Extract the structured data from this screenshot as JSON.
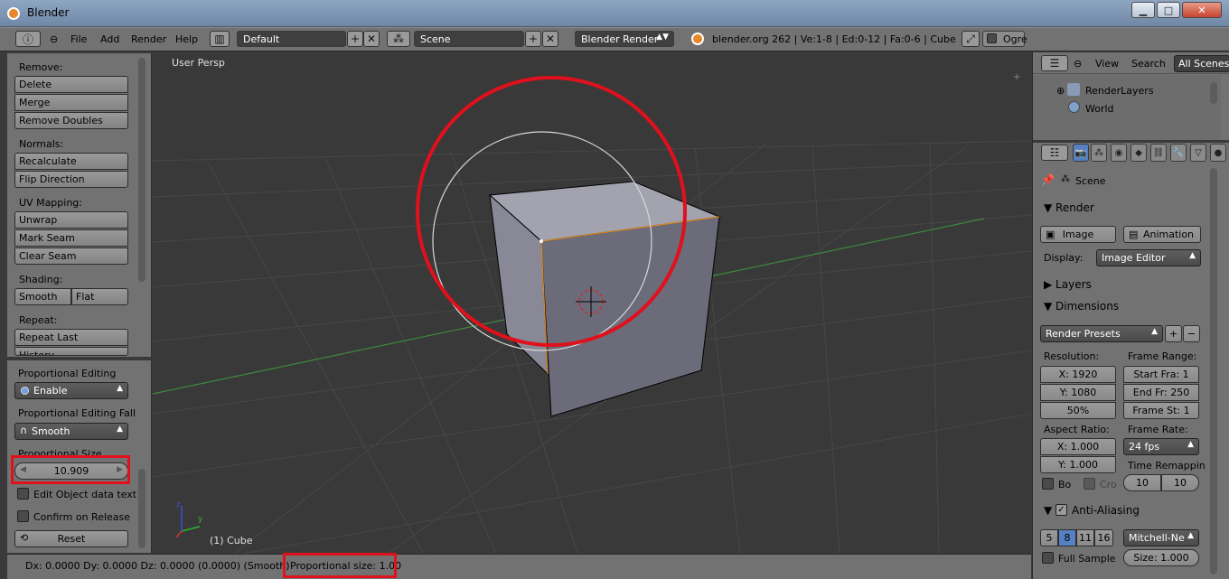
{
  "title": "Blender",
  "window_buttons": {
    "minimize": "▁",
    "maximize": "□",
    "close": "✕"
  },
  "info_bar": {
    "menus": [
      "File",
      "Add",
      "Render",
      "Help"
    ],
    "screen_layout": "Default",
    "scene": "Scene",
    "render_engine": "Blender Render",
    "stats": "blender.org 262 | Ve:1-8 | Ed:0-12 | Fa:0-6 | Cube",
    "ogre_label": "Ogre"
  },
  "tool_shelf": {
    "sections": [
      {
        "label": "Remove:",
        "buttons": [
          "Delete",
          "Merge",
          "Remove Doubles"
        ]
      },
      {
        "label": "Normals:",
        "buttons": [
          "Recalculate",
          "Flip Direction"
        ]
      },
      {
        "label": "UV Mapping:",
        "buttons": [
          "Unwrap",
          "Mark Seam",
          "Clear Seam"
        ]
      },
      {
        "label": "Shading:",
        "buttons": [
          "Smooth",
          "Flat"
        ]
      },
      {
        "label": "Repeat:",
        "buttons": [
          "Repeat Last",
          "History..."
        ]
      }
    ]
  },
  "operator_panel": {
    "prop_editing_label": "Proportional Editing",
    "prop_editing_value": "Enable",
    "falloff_label": "Proportional Editing Fall",
    "falloff_value": "Smooth",
    "size_label": "Proportional Size",
    "size_value": "10.909",
    "edit_object_label": "Edit Object data text",
    "confirm_label": "Confirm on Release",
    "reset_label": "Reset"
  },
  "viewport": {
    "view_label": "User Persp",
    "object_label": "(1) Cube",
    "axis_y": "y",
    "axis_z": "z"
  },
  "status_bar": {
    "transform": "Dx: 0.0000   Dy: 0.0000   Dz: 0.0000 (0.0000) (Smooth)",
    "proportional": "Proportional size: 1.00"
  },
  "outliner": {
    "menus": [
      "View",
      "Search"
    ],
    "filter": "All Scenes",
    "items": [
      "RenderLayers",
      "World"
    ]
  },
  "properties": {
    "context": "Scene",
    "render_header": "Render",
    "image_button": "Image",
    "animation_button": "Animation",
    "display_label": "Display:",
    "display_value": "Image Editor",
    "layers_header": "Layers",
    "dimensions_header": "Dimensions",
    "presets": "Render Presets",
    "resolution_label": "Resolution:",
    "res_x": "X: 1920",
    "res_y": "Y: 1080",
    "res_pct": "50%",
    "frame_range_label": "Frame Range:",
    "start": "Start Fra: 1",
    "end": "End Fr: 250",
    "step": "Frame St: 1",
    "aspect_label": "Aspect Ratio:",
    "aspect_x": "X: 1.000",
    "aspect_y": "Y: 1.000",
    "frame_rate_label": "Frame Rate:",
    "fps": "24 fps",
    "time_remap_label": "Time Remappin",
    "remap_old": "10",
    "remap_new": "10",
    "border_label": "Bo",
    "crop_label": "Cro",
    "aa_header": "Anti-Aliasing",
    "aa_samples": [
      "5",
      "8",
      "11",
      "16"
    ],
    "aa_filter": "Mitchell-Ne",
    "full_sample": "Full Sample",
    "filter_size": "Size: 1.000"
  },
  "colors": {
    "highlight": "#e0101c",
    "selected_tab": "#5680c2"
  }
}
